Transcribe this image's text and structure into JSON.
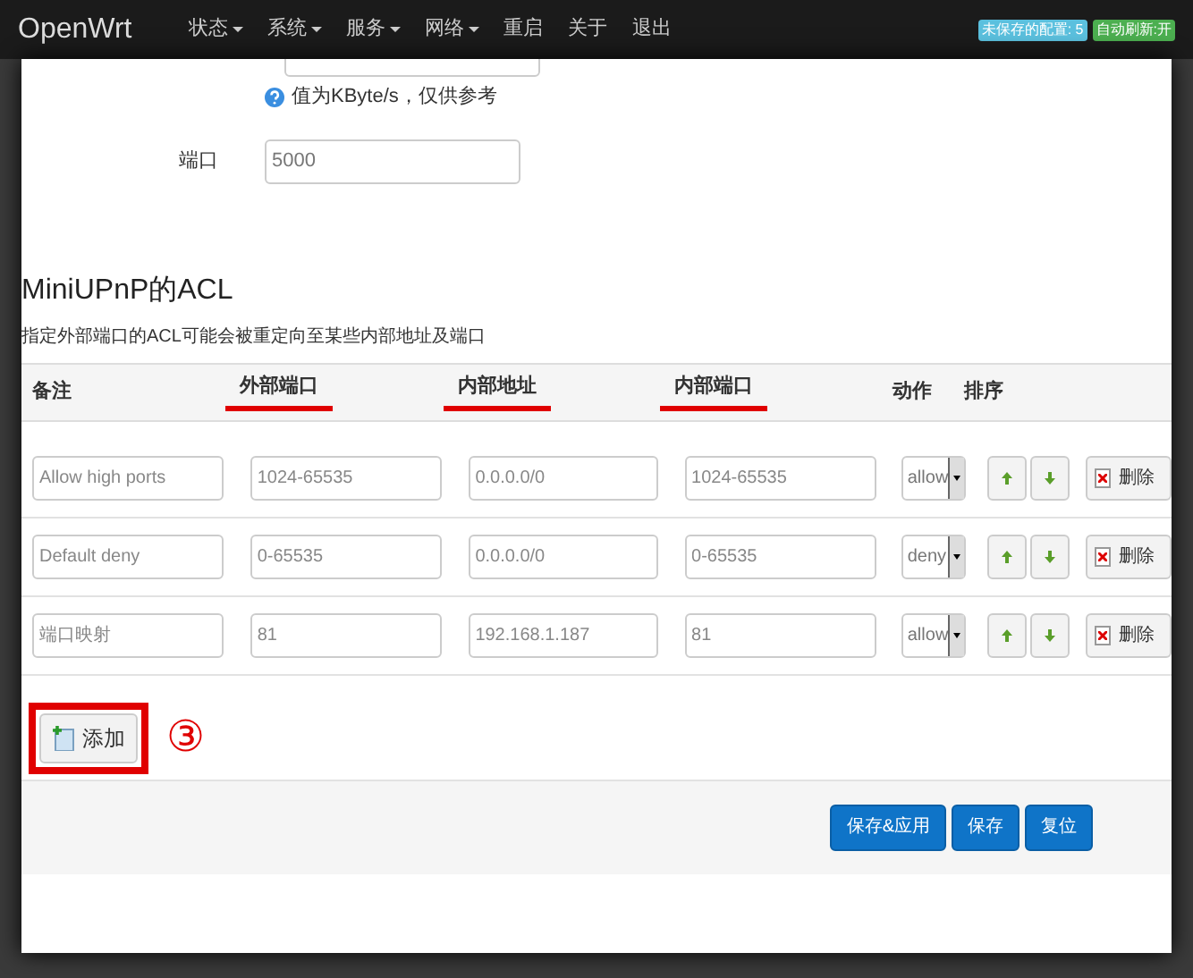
{
  "navbar": {
    "brand": "OpenWrt",
    "menu": [
      {
        "label": "状态",
        "dropdown": true
      },
      {
        "label": "系统",
        "dropdown": true
      },
      {
        "label": "服务",
        "dropdown": true
      },
      {
        "label": "网络",
        "dropdown": true
      },
      {
        "label": "重启",
        "dropdown": false
      },
      {
        "label": "关于",
        "dropdown": false
      },
      {
        "label": "退出",
        "dropdown": false
      }
    ],
    "badges": [
      {
        "text": "未保存的配置: 5",
        "color": "#5bc0de"
      },
      {
        "text": "自动刷新:开",
        "color": "#4caf50"
      }
    ]
  },
  "settings": {
    "hint": "值为KByte/s，仅供参考",
    "port_label": "端口",
    "port_value": "5000"
  },
  "acl": {
    "title": "MiniUPnP的ACL",
    "description": "指定外部端口的ACL可能会被重定向至某些内部地址及端口",
    "columns": [
      {
        "label": "备注",
        "highlighted": false
      },
      {
        "label": "外部端口",
        "highlighted": true
      },
      {
        "label": "内部地址",
        "highlighted": true
      },
      {
        "label": "内部端口",
        "highlighted": true
      },
      {
        "label": "动作",
        "highlighted": false
      },
      {
        "label": "排序",
        "highlighted": false
      }
    ],
    "rows": [
      {
        "comment": "Allow high ports",
        "ext_port": "1024-65535",
        "int_addr": "0.0.0.0/0",
        "int_port": "1024-65535",
        "action": "allow",
        "delete": "删除"
      },
      {
        "comment": "Default deny",
        "ext_port": "0-65535",
        "int_addr": "0.0.0.0/0",
        "int_port": "0-65535",
        "action": "deny",
        "delete": "删除"
      },
      {
        "comment": "端口映射",
        "ext_port": "81",
        "int_addr": "192.168.1.187",
        "int_port": "81",
        "action": "allow",
        "delete": "删除"
      }
    ],
    "add_button": "添加",
    "annotation": "③"
  },
  "footer_buttons": [
    "保存&应用",
    "保存",
    "复位"
  ]
}
